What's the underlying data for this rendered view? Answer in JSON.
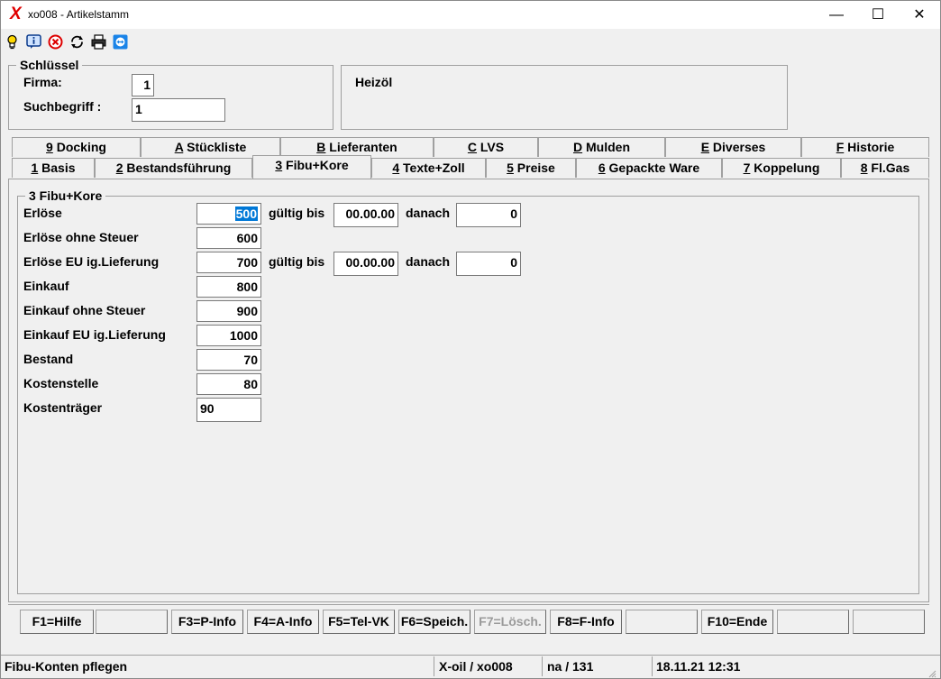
{
  "window": {
    "title": "xo008 - Artikelstamm",
    "logo": "X",
    "controls": {
      "minimize": "—",
      "maximize": "☐",
      "close": "✕"
    }
  },
  "toolbar": {
    "icons": [
      "lightbulb-icon",
      "info-icon",
      "cancel-icon",
      "refresh-icon",
      "printer-icon",
      "teamviewer-icon"
    ]
  },
  "key_group": {
    "title": "Schlüssel",
    "firma_label": "Firma:",
    "firma_value": "1",
    "suchbegriff_label": "Suchbegriff :",
    "suchbegriff_value": "1"
  },
  "article": {
    "name": "Heizöl"
  },
  "tabs_top": [
    {
      "key": "9",
      "label": " Docking"
    },
    {
      "key": "A",
      "label": " Stückliste"
    },
    {
      "key": "B",
      "label": " Lieferanten"
    },
    {
      "key": "C",
      "label": " LVS"
    },
    {
      "key": "D",
      "label": " Mulden"
    },
    {
      "key": "E",
      "label": " Diverses"
    },
    {
      "key": "F",
      "label": " Historie"
    }
  ],
  "tabs_bottom": [
    {
      "key": "1",
      "label": " Basis"
    },
    {
      "key": "2",
      "label": " Bestandsführung"
    },
    {
      "key": "3",
      "label": " Fibu+Kore"
    },
    {
      "key": "4",
      "label": " Texte+Zoll"
    },
    {
      "key": "5",
      "label": " Preise"
    },
    {
      "key": "6",
      "label": " Gepackte Ware"
    },
    {
      "key": "7",
      "label": " Koppelung"
    },
    {
      "key": "8",
      "label": " Fl.Gas"
    }
  ],
  "active_tab": "3 Fibu+Kore",
  "fibu": {
    "title": "3 Fibu+Kore",
    "rows": [
      {
        "label": "Erlöse",
        "value": "500"
      },
      {
        "label": "Erlöse ohne Steuer",
        "value": "600"
      },
      {
        "label": "Erlöse EU ig.Lieferung",
        "value": "700"
      },
      {
        "label": "Einkauf",
        "value": "800"
      },
      {
        "label": "Einkauf ohne Steuer",
        "value": "900"
      },
      {
        "label": "Einkauf EU ig.Lieferung",
        "value": "1000"
      },
      {
        "label": "Bestand",
        "value": "70"
      },
      {
        "label": "Kostenstelle",
        "value": "80"
      },
      {
        "label": "Kostenträger",
        "value": "90"
      }
    ],
    "valid_rows": [
      {
        "gueltig_label": "gültig bis",
        "gueltig_value": "00.00.00",
        "danach_label": "danach",
        "danach_value": "0"
      },
      {
        "gueltig_label": "gültig bis",
        "gueltig_value": "00.00.00",
        "danach_label": "danach",
        "danach_value": "0"
      }
    ]
  },
  "function_keys": [
    {
      "label": "F1=Hilfe",
      "enabled": true
    },
    {
      "label": "",
      "enabled": true
    },
    {
      "label": "F3=P-Info",
      "enabled": true
    },
    {
      "label": "F4=A-Info",
      "enabled": true
    },
    {
      "label": "F5=Tel-VK",
      "enabled": true
    },
    {
      "label": "F6=Speich.",
      "enabled": true
    },
    {
      "label": "F7=Lösch.",
      "enabled": false
    },
    {
      "label": "F8=F-Info",
      "enabled": true
    },
    {
      "label": "",
      "enabled": true
    },
    {
      "label": "F10=Ende",
      "enabled": true
    },
    {
      "label": "",
      "enabled": true
    },
    {
      "label": "",
      "enabled": true
    }
  ],
  "statusbar": {
    "message": "Fibu-Konten pflegen",
    "program": "X-oil / xo008",
    "user": "na / 131",
    "datetime": "18.11.21 12:31"
  },
  "colors": {
    "selection": "#0078d7",
    "logo": "#e00000",
    "disabled_text": "#9a9a9a"
  }
}
